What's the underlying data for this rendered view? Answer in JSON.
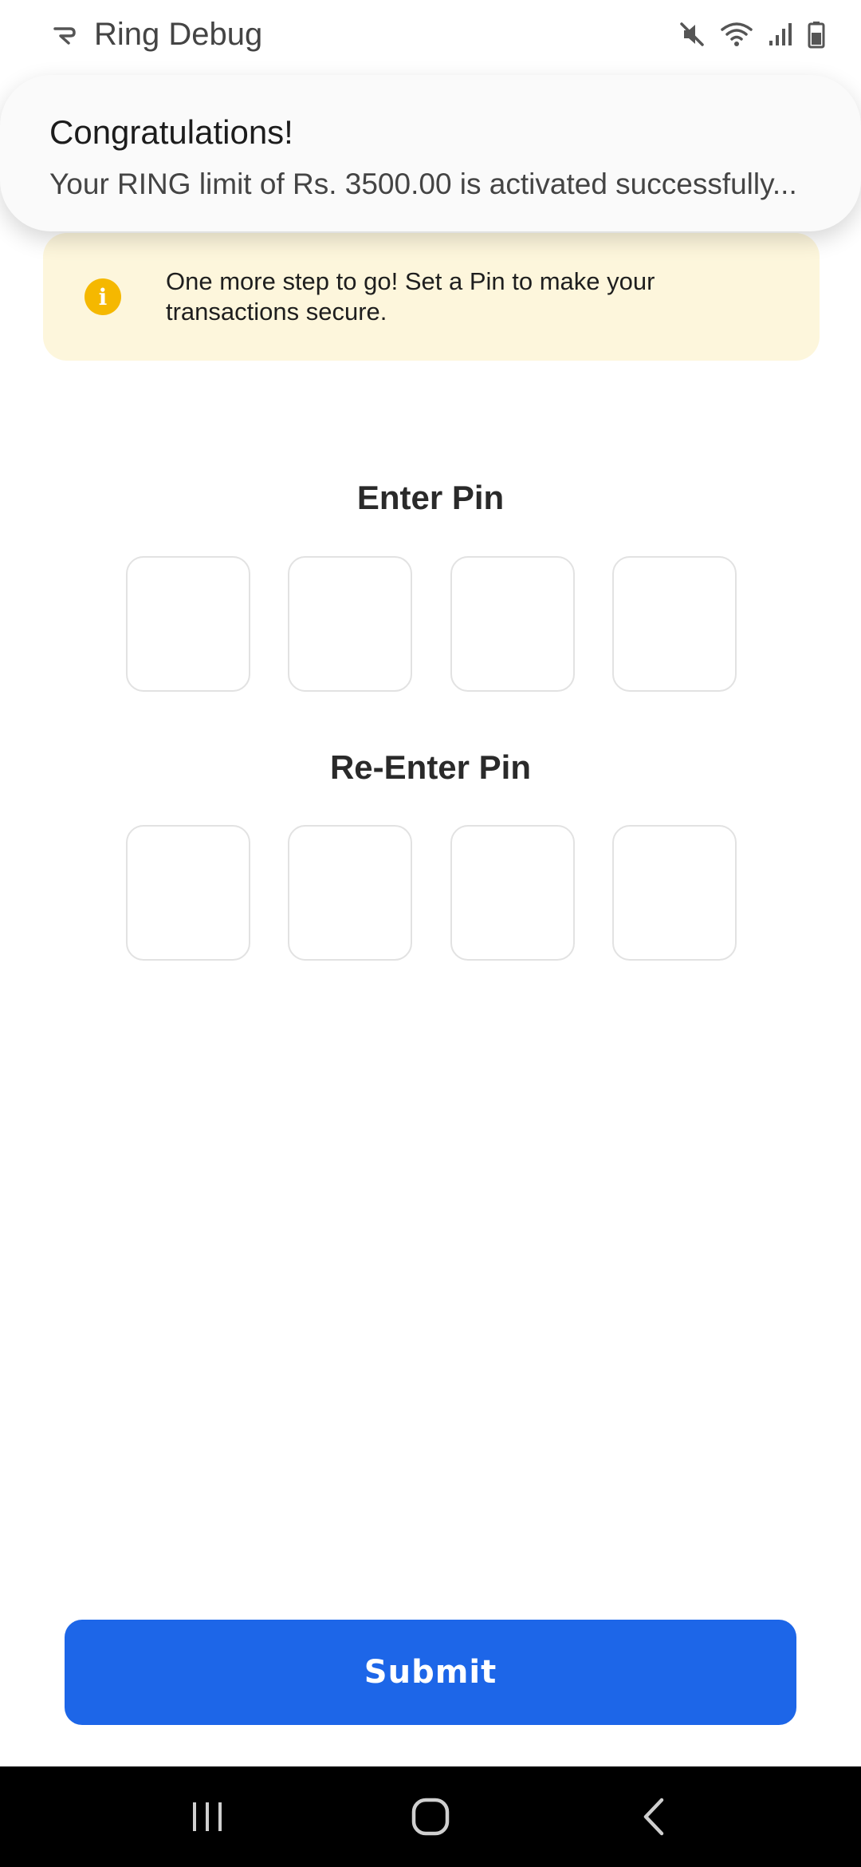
{
  "status_bar": {
    "app_name": "Ring Debug",
    "icons": [
      "ring-app-icon",
      "mute-icon",
      "wifi-icon",
      "signal-icon",
      "battery-icon"
    ]
  },
  "notification": {
    "title": "Congratulations!",
    "body": "Your RING limit of Rs. 3500.00 is activated successfully..."
  },
  "info_banner": {
    "icon": "info-icon",
    "icon_glyph": "i",
    "text": "One more step to go! Set a Pin to make your transactions secure."
  },
  "pin": {
    "enter_label": "Enter Pin",
    "reenter_label": "Re-Enter Pin",
    "enter_values": [
      "",
      "",
      "",
      ""
    ],
    "reenter_values": [
      "",
      "",
      "",
      ""
    ]
  },
  "submit": {
    "label": "Submit"
  },
  "nav": {
    "icons": [
      "recent-apps-icon",
      "home-icon",
      "back-icon"
    ]
  },
  "colors": {
    "accent": "#1d66e8",
    "banner_bg": "#fdf6dc",
    "info_icon": "#f5b800"
  }
}
